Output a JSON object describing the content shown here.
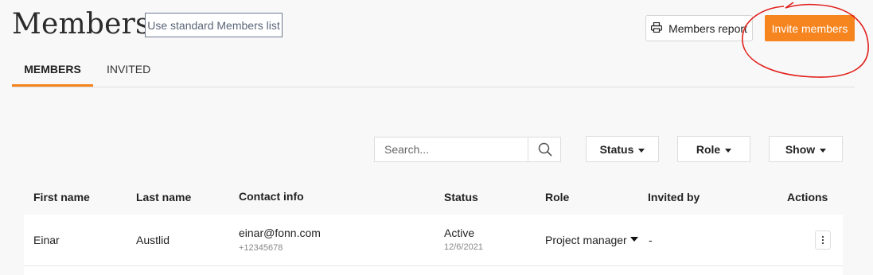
{
  "header": {
    "title": "Members",
    "standard_list_label": "Use standard Members list",
    "report_label": "Members report",
    "invite_label": "Invite members"
  },
  "tabs": [
    {
      "label": "MEMBERS",
      "active": true
    },
    {
      "label": "INVITED",
      "active": false
    }
  ],
  "search": {
    "placeholder": "Search...",
    "value": ""
  },
  "filters": {
    "status": "Status",
    "role": "Role",
    "show": "Show"
  },
  "table": {
    "columns": [
      "First name",
      "Last name",
      "Contact info",
      "Status",
      "Role",
      "Invited by",
      "Actions"
    ],
    "rows": [
      {
        "first_name": "Einar",
        "last_name": "Austlid",
        "email": "einar@fonn.com",
        "phone": "+12345678",
        "status": "Active",
        "status_date": "12/6/2021",
        "role": "Project manager",
        "invited_by": "-"
      }
    ]
  },
  "colors": {
    "accent": "#f6841f",
    "annotation": "#e0201a"
  },
  "icons": [
    "printer-icon",
    "search-icon",
    "chevron-down-icon",
    "kebab-menu-icon"
  ]
}
